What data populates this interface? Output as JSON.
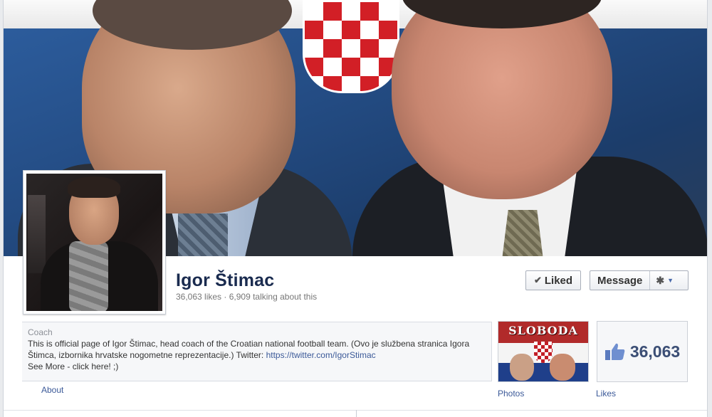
{
  "profile": {
    "name": "Igor Štimac",
    "stats": "36,063 likes · 6,909 talking about this",
    "category": "Coach",
    "description": "This is official page of Igor Štimac, head coach of the Croatian national football team. (Ovo je službena stranica Igora Štimca, izbornika hrvatske nogometne reprezentacije.) Twitter: ",
    "twitter_link": "https://twitter.com/IgorStimac",
    "see_more": "See More - click here! ;)"
  },
  "actions": {
    "liked_label": "Liked",
    "message_label": "Message"
  },
  "tabs": {
    "about": "About",
    "photos": "Photos",
    "likes": "Likes"
  },
  "thumbnails": {
    "photo_text": "SLOBODA",
    "likes_count": "36,063"
  },
  "icons": {
    "check": "check-icon",
    "gear": "gear-icon",
    "caret": "caret-down-icon",
    "like": "thumbs-up-icon"
  },
  "colors": {
    "link": "#3b5998",
    "name": "#1a2b4f",
    "likes_count": "#3b4e75"
  }
}
